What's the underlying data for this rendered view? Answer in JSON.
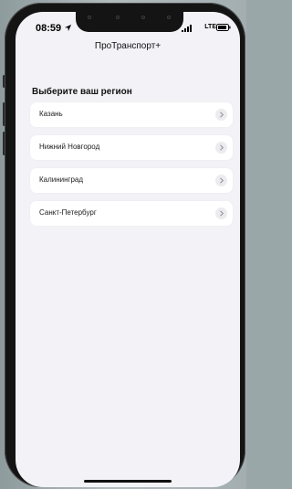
{
  "status_bar": {
    "time": "08:59",
    "network": "LTE",
    "location_icon": "location-arrow-icon",
    "signal_icon": "signal-bars-icon",
    "battery_icon": "battery-icon"
  },
  "header": {
    "title": "ПроТранспорт+"
  },
  "regions": {
    "heading": "Выберите ваш регион",
    "chevron_icon": "chevron-right-icon",
    "items": [
      {
        "label": "Казань"
      },
      {
        "label": "Нижний Новгород"
      },
      {
        "label": "Калининград"
      },
      {
        "label": "Санкт-Петербург"
      }
    ]
  },
  "colors": {
    "screen_background": "#f2f2f7",
    "card_background": "#ffffff",
    "device_frame": "#141414"
  }
}
